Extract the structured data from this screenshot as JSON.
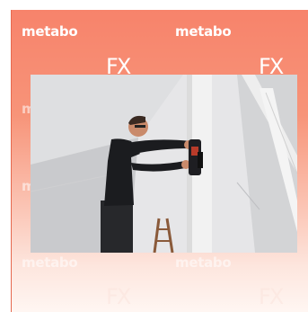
{
  "brand": {
    "wordmark": "metabo",
    "badge_text": "F"
  },
  "photo": {
    "subject_icon": "worker-installing-on-beam",
    "colors": {
      "ceiling": "#e6e6e8",
      "beam": "#f2f2f2",
      "shirt": "#1b1c1f",
      "skin": "#c98a6b",
      "tool": "#1e1e22",
      "ladder": "#8a5a3a"
    }
  },
  "colors": {
    "accent": "#f7836b",
    "wordmark": "#ffffff"
  }
}
